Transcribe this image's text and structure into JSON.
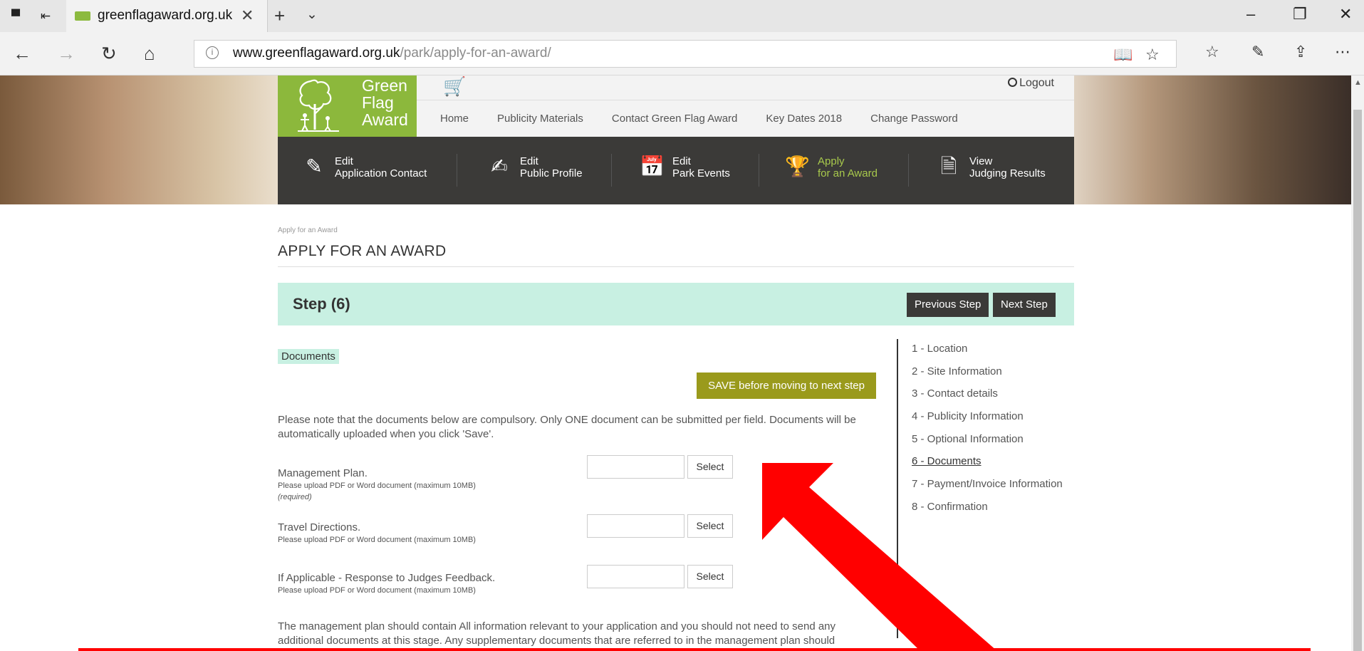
{
  "browser": {
    "tab_title": "greenflagaward.org.uk",
    "url_host": "www.greenflagaward.org.uk",
    "url_path": "/park/apply-for-an-award/"
  },
  "site": {
    "logo_text": "Green\nFlag\nAward",
    "logout": "Logout",
    "top_nav": [
      "Home",
      "Publicity Materials",
      "Contact Green Flag Award",
      "Key Dates 2018",
      "Change Password"
    ],
    "sub_nav": [
      {
        "label": "Edit\nApplication Contact",
        "icon": "edit-icon"
      },
      {
        "label": "Edit\nPublic Profile",
        "icon": "edit-profile-icon"
      },
      {
        "label": "Edit\nPark Events",
        "icon": "calendar-icon"
      },
      {
        "label": "Apply\nfor an Award",
        "icon": "trophy-icon"
      },
      {
        "label": "View\nJudging Results",
        "icon": "document-icon"
      }
    ],
    "active_color": "#a8c94c",
    "brand_green": "#8cb83c"
  },
  "page": {
    "breadcrumb": "Apply for an Award",
    "title": "APPLY FOR AN AWARD",
    "step_title": "Step (6)",
    "prev_button": "Previous Step",
    "next_button": "Next Step",
    "section_tag": "Documents",
    "save_button": "SAVE before moving to next step",
    "note": "Please note that the documents below are compulsory. Only ONE document can be submitted per field. Documents will be automatically uploaded when you click 'Save'.",
    "fields": [
      {
        "label": "Management Plan.",
        "hint": "Please upload PDF or Word document (maximum 10MB)",
        "required": "(required)",
        "button": "Select"
      },
      {
        "label": "Travel Directions.",
        "hint": "Please upload PDF or Word document (maximum 10MB)",
        "button": "Select"
      },
      {
        "label": "If Applicable - Response to Judges Feedback.",
        "hint": "Please upload PDF or Word document (maximum 10MB)",
        "button": "Select"
      }
    ],
    "bottom_note": "The management plan should contain All information relevant to your application and you should not need to send any additional documents at this stage. Any supplementary documents that are referred to in the management plan should",
    "steps": [
      "1 - Location",
      "2 - Site Information",
      "3 - Contact details",
      "4 - Publicity Information",
      "5 - Optional Information",
      "6 - Documents",
      "7 - Payment/Invoice Information",
      "8 - Confirmation"
    ],
    "current_step_index": 5
  },
  "annotation": {
    "arrow_color": "#ff0000"
  }
}
